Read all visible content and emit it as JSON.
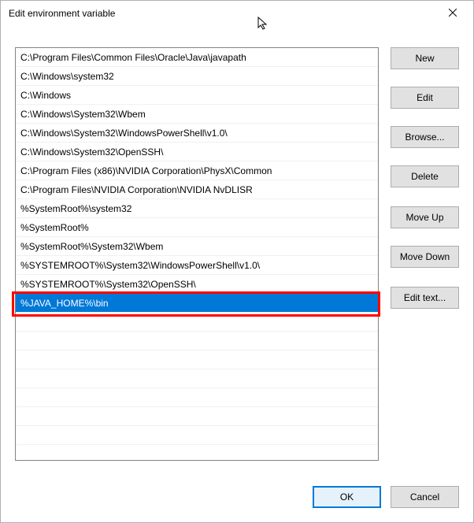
{
  "window": {
    "title": "Edit environment variable"
  },
  "list": {
    "items": [
      "C:\\Program Files\\Common Files\\Oracle\\Java\\javapath",
      "C:\\Windows\\system32",
      "C:\\Windows",
      "C:\\Windows\\System32\\Wbem",
      "C:\\Windows\\System32\\WindowsPowerShell\\v1.0\\",
      "C:\\Windows\\System32\\OpenSSH\\",
      "C:\\Program Files (x86)\\NVIDIA Corporation\\PhysX\\Common",
      "C:\\Program Files\\NVIDIA Corporation\\NVIDIA NvDLISR",
      "%SystemRoot%\\system32",
      "%SystemRoot%",
      "%SystemRoot%\\System32\\Wbem",
      "%SYSTEMROOT%\\System32\\WindowsPowerShell\\v1.0\\",
      "%SYSTEMROOT%\\System32\\OpenSSH\\",
      "%JAVA_HOME%\\bin"
    ],
    "selected_index": 13,
    "highlighted_index": 13
  },
  "buttons": {
    "new": "New",
    "edit": "Edit",
    "browse": "Browse...",
    "delete": "Delete",
    "move_up": "Move Up",
    "move_down": "Move Down",
    "edit_text": "Edit text...",
    "ok": "OK",
    "cancel": "Cancel"
  }
}
